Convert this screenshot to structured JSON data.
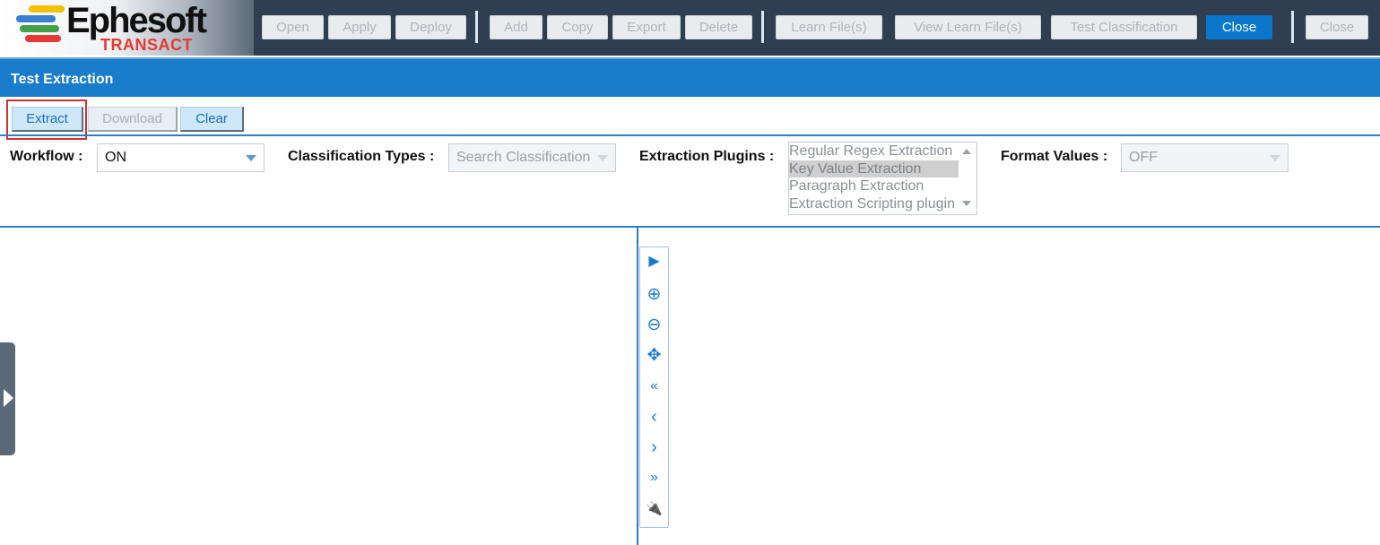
{
  "app": {
    "name": "Ephesoft",
    "subtitle": "TRANSACT"
  },
  "toolbar": {
    "open": "Open",
    "apply": "Apply",
    "deploy": "Deploy",
    "add": "Add",
    "copy": "Copy",
    "export": "Export",
    "delete": "Delete",
    "learn_files": "Learn File(s)",
    "view_learn_files": "View Learn File(s)",
    "test_classification": "Test Classification",
    "close_active": "Close",
    "close": "Close"
  },
  "panel": {
    "title": "Test Extraction"
  },
  "actions": {
    "extract": "Extract",
    "download": "Download",
    "clear": "Clear"
  },
  "filters": {
    "workflow_label": "Workflow :",
    "workflow_value": "ON",
    "classification_label": "Classification Types :",
    "classification_placeholder": "Search Classification",
    "plugins_label": "Extraction Plugins :",
    "plugins": [
      {
        "label": "Regular Regex Extraction",
        "selected": false
      },
      {
        "label": "Key Value Extraction",
        "selected": true
      },
      {
        "label": "Paragraph Extraction",
        "selected": false
      },
      {
        "label": "Extraction Scripting plugin",
        "selected": false
      }
    ],
    "format_label": "Format Values :",
    "format_value": "OFF"
  },
  "viewer_tools": [
    {
      "name": "play-icon",
      "glyph": "▶"
    },
    {
      "name": "zoom-in-icon",
      "glyph": "⊕"
    },
    {
      "name": "zoom-out-icon",
      "glyph": "⊖"
    },
    {
      "name": "move-icon",
      "glyph": "✥"
    },
    {
      "name": "first-page-icon",
      "glyph": "«"
    },
    {
      "name": "prev-page-icon",
      "glyph": "‹"
    },
    {
      "name": "next-page-icon",
      "glyph": "›"
    },
    {
      "name": "last-page-icon",
      "glyph": "»"
    },
    {
      "name": "plugin-icon",
      "glyph": "🔌"
    }
  ]
}
